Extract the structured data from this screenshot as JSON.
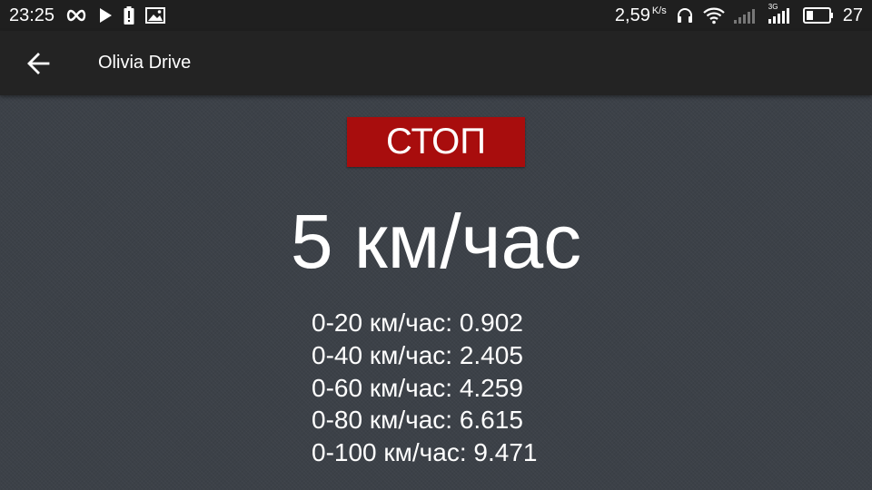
{
  "status_bar": {
    "time": "23:25",
    "left_icons": [
      "infinity-icon",
      "play-icon",
      "battery-alert-icon",
      "image-icon"
    ],
    "network_speed": "2,59",
    "network_speed_unit": "K/s",
    "network_type": "3G",
    "battery_level": "27",
    "right_icons": [
      "headphones-icon",
      "wifi-icon",
      "signal-icon",
      "signal-3g-icon",
      "battery-icon"
    ]
  },
  "app_bar": {
    "title": "Olivia Drive",
    "back_icon": "arrow-back-icon"
  },
  "stop_button": {
    "label": "СТОП",
    "color": "#a80d0d"
  },
  "current_speed": "5 км/час",
  "results": [
    {
      "label": "0-20 км/час: 0.902"
    },
    {
      "label": "0-40 км/час: 2.405"
    },
    {
      "label": "0-60 км/час: 4.259"
    },
    {
      "label": "0-80 км/час: 6.615"
    },
    {
      "label": "0-100 км/час: 9.471"
    }
  ]
}
